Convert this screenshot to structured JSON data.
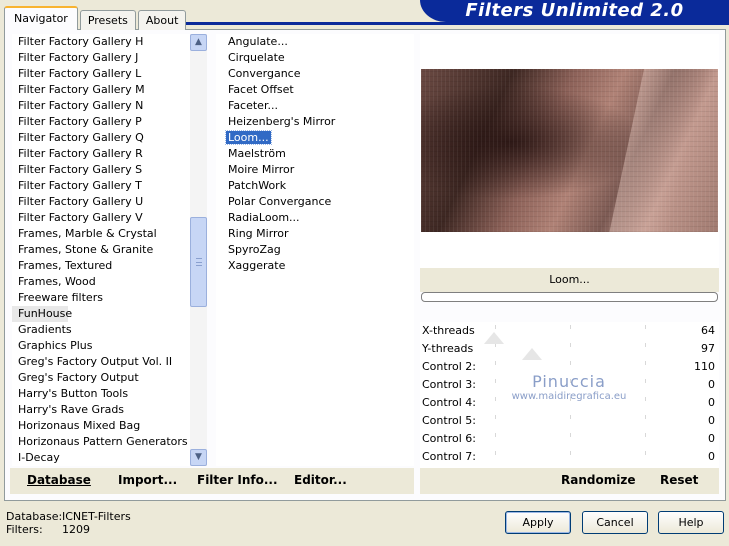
{
  "tabs": [
    "Navigator",
    "Presets",
    "About"
  ],
  "banner_title": "Filters Unlimited 2.0",
  "categories": [
    "Filter Factory Gallery H",
    "Filter Factory Gallery J",
    "Filter Factory Gallery L",
    "Filter Factory Gallery M",
    "Filter Factory Gallery N",
    "Filter Factory Gallery P",
    "Filter Factory Gallery Q",
    "Filter Factory Gallery R",
    "Filter Factory Gallery S",
    "Filter Factory Gallery T",
    "Filter Factory Gallery U",
    "Filter Factory Gallery V",
    "Frames, Marble & Crystal",
    "Frames, Stone & Granite",
    "Frames, Textured",
    "Frames, Wood",
    "Freeware filters",
    "FunHouse",
    "Gradients",
    "Graphics Plus",
    "Greg's Factory Output Vol. II",
    "Greg's Factory Output",
    "Harry's Button Tools",
    "Harry's Rave Grads",
    "Horizonaus Mixed Bag",
    "Horizonaus Pattern Generators",
    "I-Decay"
  ],
  "selected_category": "FunHouse",
  "filters": [
    "Angulate...",
    "Cirquelate",
    "Convergance",
    "Facet Offset",
    "Faceter...",
    "Heizenberg's Mirror",
    "Loom...",
    "Maelström",
    "Moire Mirror",
    "PatchWork",
    "Polar Convergance",
    "RadiaLoom...",
    "Ring Mirror",
    "SpyroZag",
    "Xaggerate"
  ],
  "selected_filter": "Loom...",
  "current_filter_name": "Loom...",
  "controls": [
    {
      "label": "X-threads",
      "value": "64"
    },
    {
      "label": "Y-threads",
      "value": "97"
    },
    {
      "label": "Control 2:",
      "value": "110"
    },
    {
      "label": "Control 3:",
      "value": "0"
    },
    {
      "label": "Control 4:",
      "value": "0"
    },
    {
      "label": "Control 5:",
      "value": "0"
    },
    {
      "label": "Control 6:",
      "value": "0"
    },
    {
      "label": "Control 7:",
      "value": "0"
    }
  ],
  "watermark": {
    "line1": "Pinuccia",
    "line2": "www.maidiregrafica.eu"
  },
  "left_buttons": {
    "database": "Database",
    "import": "Import...",
    "filter_info": "Filter Info...",
    "editor": "Editor..."
  },
  "right_buttons": {
    "randomize": "Randomize",
    "reset": "Reset"
  },
  "footer": {
    "database_label": "Database:",
    "database_value": "ICNET-Filters",
    "filters_label": "Filters:",
    "filters_value": "1209"
  },
  "dialog_buttons": {
    "apply": "Apply",
    "cancel": "Cancel",
    "help": "Help"
  },
  "scroll": {
    "up_glyph": "▲",
    "down_glyph": "▼"
  }
}
